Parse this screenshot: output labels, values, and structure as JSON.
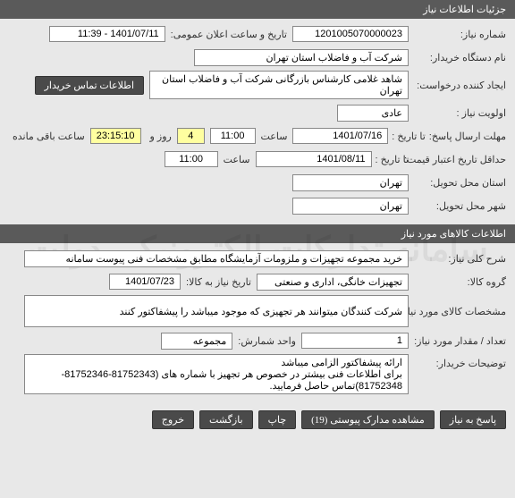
{
  "sections": {
    "need_info": "جزئیات اطلاعات نیاز",
    "items_info": "اطلاعات کالاهای مورد نیاز"
  },
  "labels": {
    "need_number": "شماره نیاز:",
    "announce_datetime": "تاریخ و ساعت اعلان عمومی:",
    "buyer_org": "نام دستگاه خریدار:",
    "request_creator": "ایجاد کننده درخواست:",
    "buyer_contact_btn": "اطلاعات تماس خریدار",
    "priority": "اولویت نیاز :",
    "reply_deadline": "مهلت ارسال پاسخ:",
    "to_date": "تا تاریخ :",
    "hour": "ساعت",
    "days_and": "روز و",
    "remaining": "ساعت باقی مانده",
    "price_validity": "حداقل تاریخ اعتبار قیمت:",
    "delivery_province": "استان محل تحویل:",
    "delivery_city": "شهر محل تحویل:",
    "need_desc": "شرح کلی نیاز:",
    "goods_group": "گروه کالا:",
    "need_to_goods_date": "تاریخ نیاز به کالا:",
    "goods_spec": "مشخصات کالای مورد نیاز:",
    "qty": "تعداد / مقدار مورد نیاز:",
    "unit": "واحد شمارش:",
    "buyer_notes": "توضیحات خریدار:"
  },
  "values": {
    "need_number": "1201005070000023",
    "announce_datetime": "1401/07/11 - 11:39",
    "buyer_org": "شرکت آب و فاضلاب استان تهران",
    "request_creator": "شاهد غلامی کارشناس بازرگانی شرکت آب و فاضلاب استان تهران",
    "priority": "عادی",
    "reply_to_date": "1401/07/16",
    "reply_hour": "11:00",
    "days_left": "4",
    "time_left": "23:15:10",
    "price_to_date": "1401/08/11",
    "price_hour": "11:00",
    "delivery_province": "تهران",
    "delivery_city": "تهران",
    "need_desc": "خرید مجموعه تجهیزات و ملزومات آزمایشگاه مطابق مشخصات فنی پیوست سامانه",
    "goods_group": "تجهیزات خانگی، اداری و صنعتی",
    "need_to_goods_date": "1401/07/23",
    "goods_spec": "شرکت کنندگان میتوانند هر تجهیزی که موجود میباشد را پیشفاکتور کنند",
    "qty": "1",
    "unit": "مجموعه",
    "buyer_notes": "ارائه پیشفاکتور الزامی میباشد\nبرای اطلاعات فنی بیشتر در خصوص هر تجهیز با شماره های (81752343-81752346-81752348)تماس حاصل فرمایید."
  },
  "buttons": {
    "reply": "پاسخ به نیاز",
    "attachments": "مشاهده مدارک پیوستی (19)",
    "print": "چاپ",
    "back": "بازگشت",
    "exit": "خروج"
  },
  "watermark": "سامانه تدارکات الکترونیکی دولت"
}
